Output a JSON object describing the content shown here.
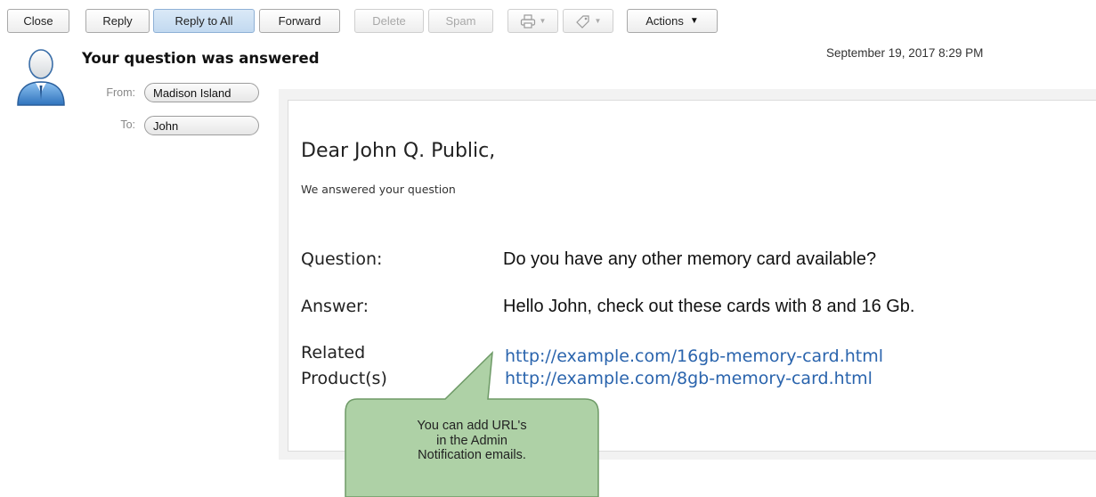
{
  "toolbar": {
    "close": "Close",
    "reply": "Reply",
    "reply_all": "Reply to All",
    "forward": "Forward",
    "delete": "Delete",
    "spam": "Spam",
    "actions": "Actions"
  },
  "message": {
    "subject": "Your question was answered",
    "date": "September 19, 2017 8:29 PM",
    "from_label": "From:",
    "from": "Madison Island",
    "to_label": "To:",
    "to": "John"
  },
  "body": {
    "greeting": "Dear John Q. Public,",
    "intro": "We answered your question",
    "question_label": "Question:",
    "question": "Do you have any other memory card available?",
    "answer_label": "Answer:",
    "answer": "Hello John, check out these cards with 8 and 16 Gb.",
    "related_label_1": "Related",
    "related_label_2": "Product(s)",
    "links": [
      "http://example.com/16gb-memory-card.html",
      "http://example.com/8gb-memory-card.html"
    ]
  },
  "callout": {
    "line1": "You can add URL's",
    "line2": "in the Admin",
    "line3": "Notification emails."
  },
  "colors": {
    "callout_fill": "#aed1a6",
    "callout_border": "#6e9a67",
    "link": "#2a64ad",
    "avatar": "#3d7fc6"
  }
}
